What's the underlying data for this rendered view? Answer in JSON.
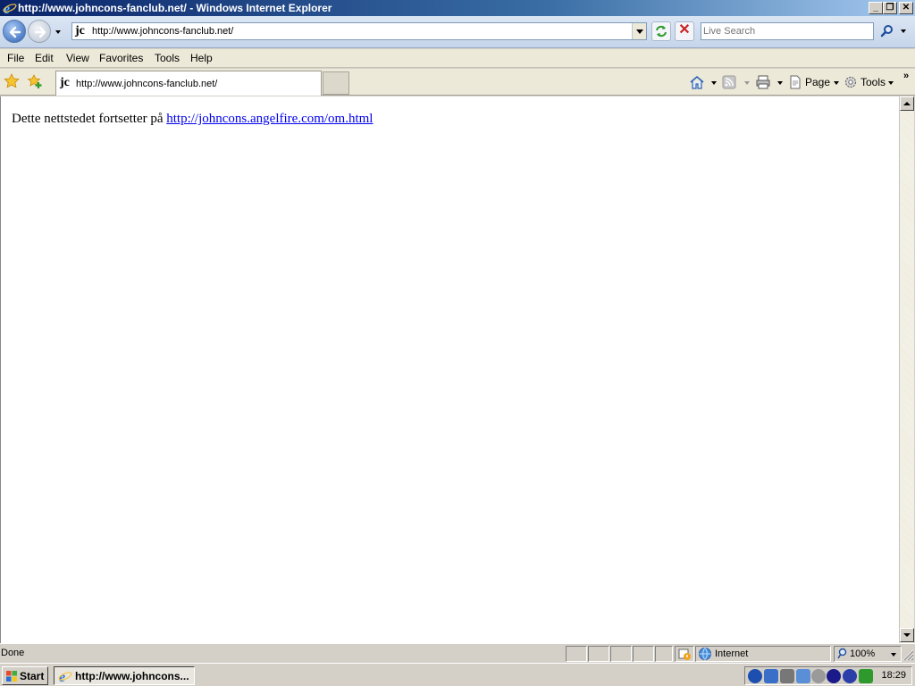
{
  "window": {
    "title": "http://www.johncons-fanclub.net/ - Windows Internet Explorer"
  },
  "address_bar": {
    "url": "http://www.johncons-fanclub.net/",
    "favicon_text": "jc"
  },
  "search": {
    "placeholder": "Live Search"
  },
  "menu": {
    "items": [
      "File",
      "Edit",
      "View",
      "Favorites",
      "Tools",
      "Help"
    ]
  },
  "tab": {
    "title": "http://www.johncons-fanclub.net/"
  },
  "command_bar": {
    "page_label": "Page",
    "tools_label": "Tools"
  },
  "content": {
    "text": "Dette nettstedet fortsetter på ",
    "link_text": "http://johncons.angelfire.com/om.html",
    "link_href": "http://johncons.angelfire.com/om.html"
  },
  "status_bar": {
    "status_text": "Done",
    "zone": "Internet",
    "zoom": "100%"
  },
  "taskbar": {
    "start_label": "Start",
    "task_label": "http://www.johncons...",
    "clock": "18:29"
  },
  "colors": {
    "titlebar_start": "#0a246a",
    "link": "#0000ee",
    "chrome": "#d4d0c8"
  }
}
